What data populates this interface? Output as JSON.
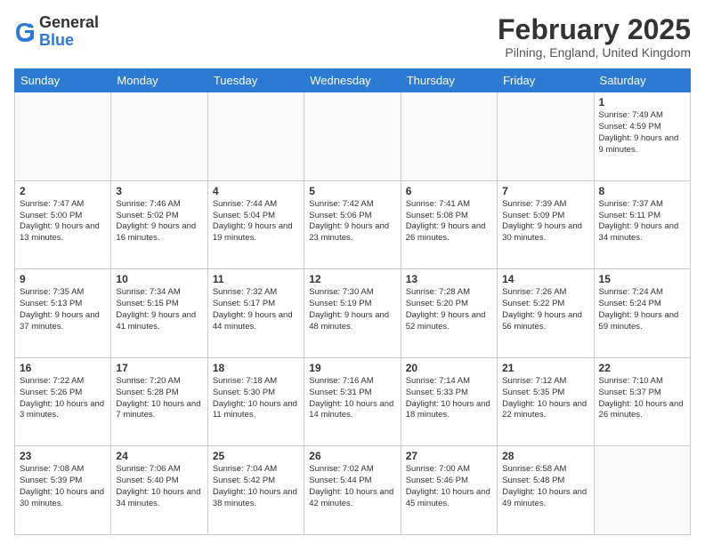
{
  "logo": {
    "general": "General",
    "blue": "Blue"
  },
  "header": {
    "month": "February 2025",
    "location": "Pilning, England, United Kingdom"
  },
  "days_of_week": [
    "Sunday",
    "Monday",
    "Tuesday",
    "Wednesday",
    "Thursday",
    "Friday",
    "Saturday"
  ],
  "weeks": [
    [
      null,
      null,
      null,
      null,
      null,
      null,
      {
        "day": "1",
        "sunrise": "7:49 AM",
        "sunset": "4:59 PM",
        "daylight": "9 hours and 9 minutes."
      }
    ],
    [
      {
        "day": "2",
        "sunrise": "7:47 AM",
        "sunset": "5:00 PM",
        "daylight": "9 hours and 13 minutes."
      },
      {
        "day": "3",
        "sunrise": "7:46 AM",
        "sunset": "5:02 PM",
        "daylight": "9 hours and 16 minutes."
      },
      {
        "day": "4",
        "sunrise": "7:44 AM",
        "sunset": "5:04 PM",
        "daylight": "9 hours and 19 minutes."
      },
      {
        "day": "5",
        "sunrise": "7:42 AM",
        "sunset": "5:06 PM",
        "daylight": "9 hours and 23 minutes."
      },
      {
        "day": "6",
        "sunrise": "7:41 AM",
        "sunset": "5:08 PM",
        "daylight": "9 hours and 26 minutes."
      },
      {
        "day": "7",
        "sunrise": "7:39 AM",
        "sunset": "5:09 PM",
        "daylight": "9 hours and 30 minutes."
      },
      {
        "day": "8",
        "sunrise": "7:37 AM",
        "sunset": "5:11 PM",
        "daylight": "9 hours and 34 minutes."
      }
    ],
    [
      {
        "day": "9",
        "sunrise": "7:35 AM",
        "sunset": "5:13 PM",
        "daylight": "9 hours and 37 minutes."
      },
      {
        "day": "10",
        "sunrise": "7:34 AM",
        "sunset": "5:15 PM",
        "daylight": "9 hours and 41 minutes."
      },
      {
        "day": "11",
        "sunrise": "7:32 AM",
        "sunset": "5:17 PM",
        "daylight": "9 hours and 44 minutes."
      },
      {
        "day": "12",
        "sunrise": "7:30 AM",
        "sunset": "5:19 PM",
        "daylight": "9 hours and 48 minutes."
      },
      {
        "day": "13",
        "sunrise": "7:28 AM",
        "sunset": "5:20 PM",
        "daylight": "9 hours and 52 minutes."
      },
      {
        "day": "14",
        "sunrise": "7:26 AM",
        "sunset": "5:22 PM",
        "daylight": "9 hours and 56 minutes."
      },
      {
        "day": "15",
        "sunrise": "7:24 AM",
        "sunset": "5:24 PM",
        "daylight": "9 hours and 59 minutes."
      }
    ],
    [
      {
        "day": "16",
        "sunrise": "7:22 AM",
        "sunset": "5:26 PM",
        "daylight": "10 hours and 3 minutes."
      },
      {
        "day": "17",
        "sunrise": "7:20 AM",
        "sunset": "5:28 PM",
        "daylight": "10 hours and 7 minutes."
      },
      {
        "day": "18",
        "sunrise": "7:18 AM",
        "sunset": "5:30 PM",
        "daylight": "10 hours and 11 minutes."
      },
      {
        "day": "19",
        "sunrise": "7:16 AM",
        "sunset": "5:31 PM",
        "daylight": "10 hours and 14 minutes."
      },
      {
        "day": "20",
        "sunrise": "7:14 AM",
        "sunset": "5:33 PM",
        "daylight": "10 hours and 18 minutes."
      },
      {
        "day": "21",
        "sunrise": "7:12 AM",
        "sunset": "5:35 PM",
        "daylight": "10 hours and 22 minutes."
      },
      {
        "day": "22",
        "sunrise": "7:10 AM",
        "sunset": "5:37 PM",
        "daylight": "10 hours and 26 minutes."
      }
    ],
    [
      {
        "day": "23",
        "sunrise": "7:08 AM",
        "sunset": "5:39 PM",
        "daylight": "10 hours and 30 minutes."
      },
      {
        "day": "24",
        "sunrise": "7:06 AM",
        "sunset": "5:40 PM",
        "daylight": "10 hours and 34 minutes."
      },
      {
        "day": "25",
        "sunrise": "7:04 AM",
        "sunset": "5:42 PM",
        "daylight": "10 hours and 38 minutes."
      },
      {
        "day": "26",
        "sunrise": "7:02 AM",
        "sunset": "5:44 PM",
        "daylight": "10 hours and 42 minutes."
      },
      {
        "day": "27",
        "sunrise": "7:00 AM",
        "sunset": "5:46 PM",
        "daylight": "10 hours and 45 minutes."
      },
      {
        "day": "28",
        "sunrise": "6:58 AM",
        "sunset": "5:48 PM",
        "daylight": "10 hours and 49 minutes."
      },
      null
    ]
  ]
}
